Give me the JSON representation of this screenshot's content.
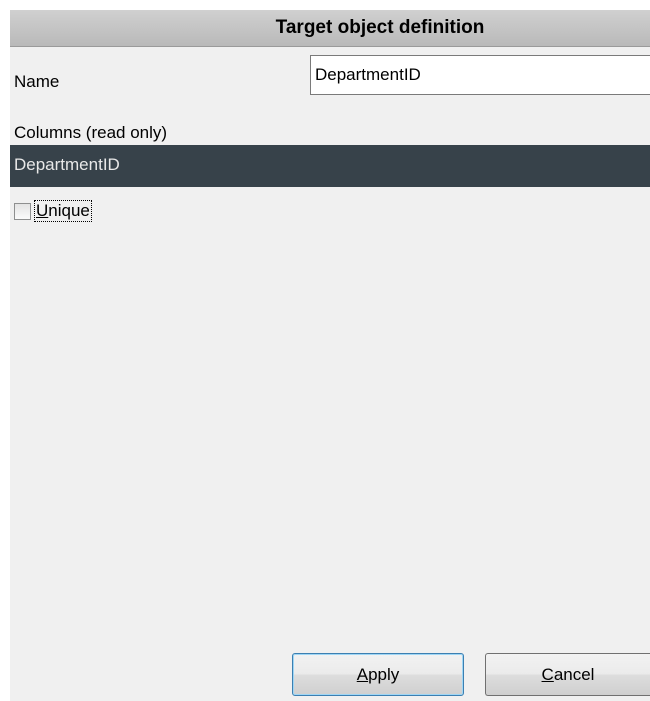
{
  "header": {
    "title": "Target object definition"
  },
  "name": {
    "label": "Name",
    "value": "DepartmentID"
  },
  "columns": {
    "label": "Columns (read only)",
    "items": [
      "DepartmentID"
    ]
  },
  "unique": {
    "label_accel": "U",
    "label_rest": "nique",
    "checked": false
  },
  "buttons": {
    "apply": {
      "accel": "A",
      "rest": "pply"
    },
    "cancel": {
      "accel": "C",
      "rest": "ancel"
    }
  },
  "colors": {
    "panel_bg": "#f0f0f0",
    "header_bg": "#c4c4c4",
    "selected_row_bg": "#37424a",
    "default_button_border": "#3c7fb1"
  }
}
